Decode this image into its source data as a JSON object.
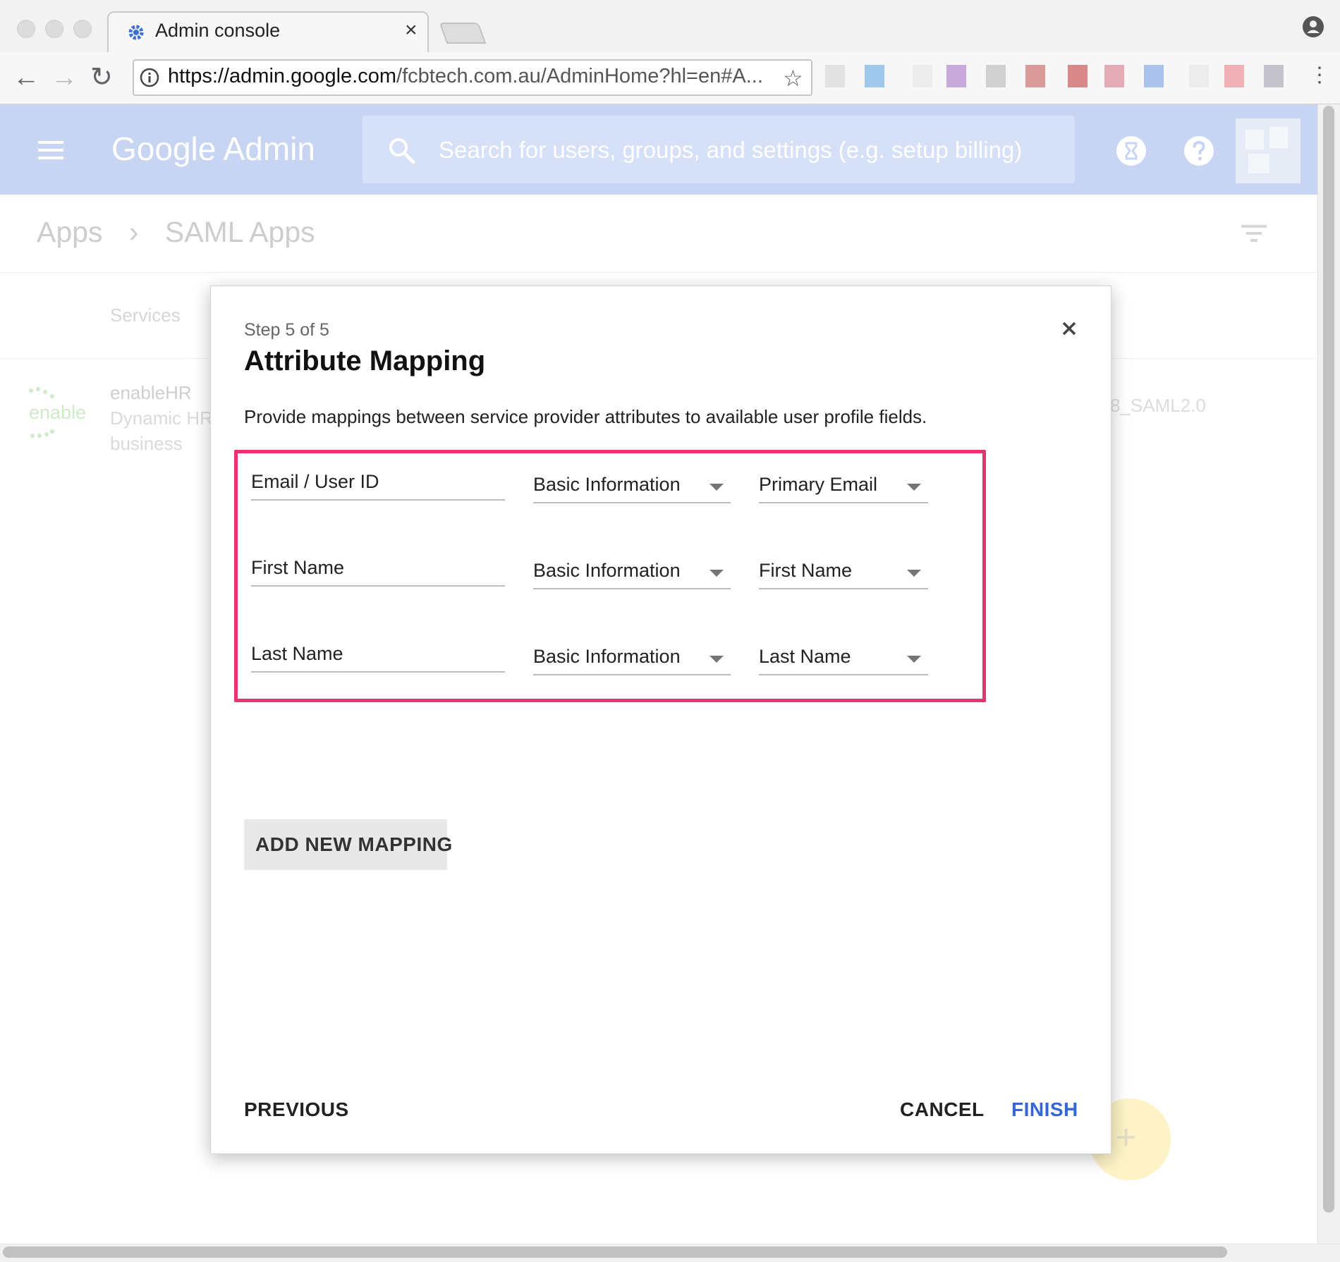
{
  "browser": {
    "tab_title": "Admin console",
    "tab_close": "×",
    "url_host": "https://admin.google.com",
    "url_path": "/fcbtech.com.au/AdminHome?hl=en#A...",
    "back_glyph": "←",
    "forward_glyph": "→",
    "reload_glyph": "↻",
    "star_glyph": "☆",
    "menu_glyph": "⋮"
  },
  "header": {
    "brand": "Google Admin",
    "search_placeholder": "Search for users, groups, and settings (e.g. setup billing)"
  },
  "page": {
    "breadcrumb": [
      "Apps",
      "›",
      "SAML Apps"
    ],
    "column_services": "Services",
    "app_name": "enableHR",
    "app_desc_line1": "Dynamic HR",
    "app_desc_line2": "business",
    "app_saml_suffix": "8_SAML2.0",
    "fab_glyph": "+"
  },
  "dialog": {
    "step": "Step 5 of 5",
    "title": "Attribute Mapping",
    "description": "Provide mappings between service provider attributes to available user profile fields.",
    "mappings": [
      {
        "attribute": "Email / User ID",
        "category": "Basic Information",
        "field": "Primary Email"
      },
      {
        "attribute": "First Name",
        "category": "Basic Information",
        "field": "First Name"
      },
      {
        "attribute": "Last Name",
        "category": "Basic Information",
        "field": "Last Name"
      }
    ],
    "add_mapping_label": "ADD NEW MAPPING",
    "previous_label": "PREVIOUS",
    "cancel_label": "CANCEL",
    "finish_label": "FINISH"
  },
  "colors": {
    "header_bg": "#c7d5f3",
    "highlight": "#e8336e",
    "finish_blue": "#3367d6"
  },
  "icons": [
    "admin-gear-icon",
    "close-icon",
    "back-arrow-icon",
    "forward-arrow-icon",
    "reload-icon",
    "info-icon",
    "star-icon",
    "profile-icon",
    "hamburger-menu-icon",
    "search-icon",
    "hourglass-icon",
    "help-icon",
    "filter-icon",
    "chevron-down-icon"
  ]
}
